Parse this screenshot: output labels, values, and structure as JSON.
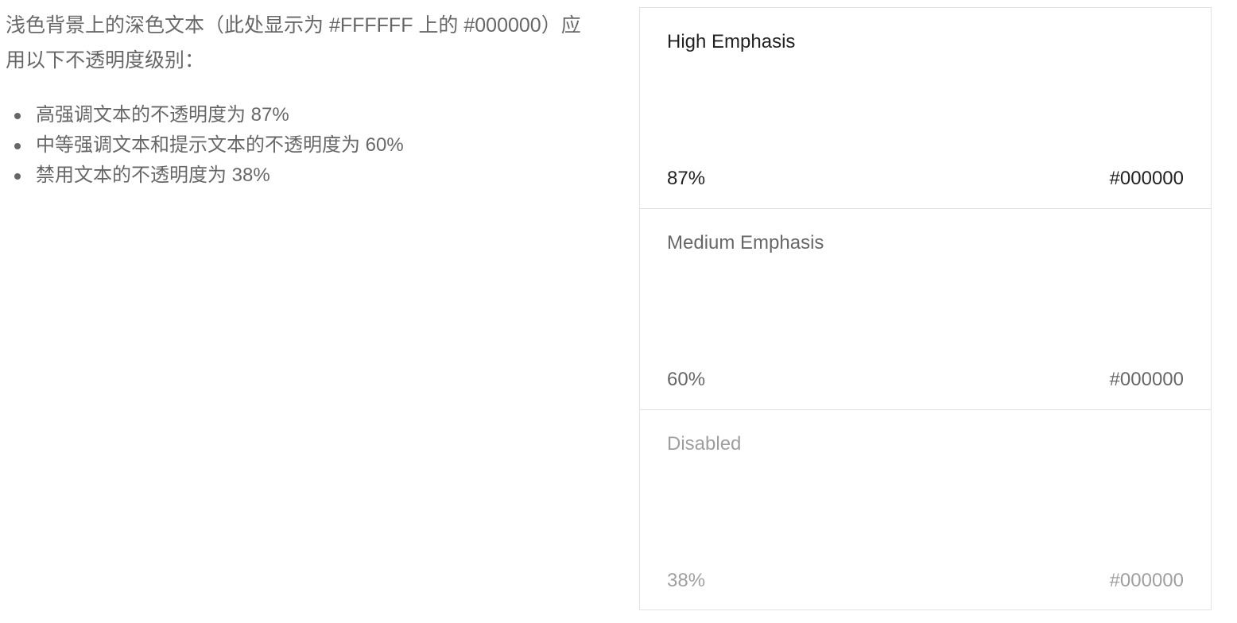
{
  "description": {
    "intro": "浅色背景上的深色文本（此处显示为 #FFFFFF 上的 #000000）应用以下不透明度级别：",
    "bullets": [
      "高强调文本的不透明度为 87%",
      "中等强调文本和提示文本的不透明度为 60%",
      "禁用文本的不透明度为 38%"
    ]
  },
  "swatches": [
    {
      "name": "High Emphasis",
      "opacity": "87%",
      "hex": "#000000"
    },
    {
      "name": "Medium Emphasis",
      "opacity": "60%",
      "hex": "#000000"
    },
    {
      "name": "Disabled",
      "opacity": "38%",
      "hex": "#000000"
    }
  ],
  "colors": {
    "text": "#000000",
    "background": "#FFFFFF",
    "border": "#E2E2E2"
  }
}
